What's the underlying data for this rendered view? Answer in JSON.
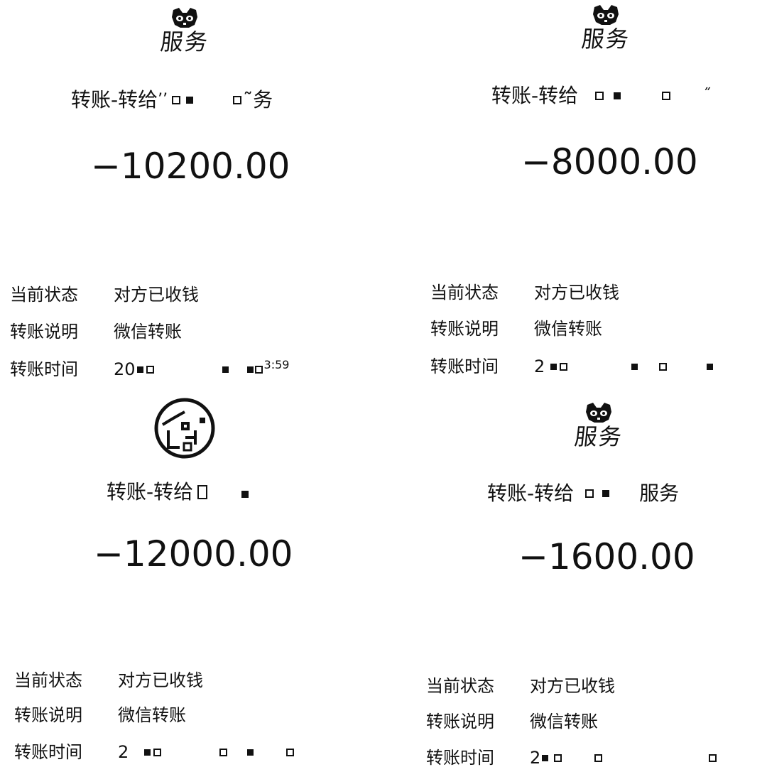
{
  "panels": [
    {
      "avatar_icon": "pixel-cat-icon",
      "avatar_name": "服务",
      "title_prefix": "转账-转给",
      "title_fragment_a": "’’",
      "title_fragment_b": "˜务",
      "amount": "−10200.00",
      "details": [
        {
          "label": "当前状态",
          "value": "对方已收钱"
        },
        {
          "label": "转账说明",
          "value": "微信转账"
        },
        {
          "label": "转账时间",
          "value_prefix": "20",
          "value_suffix": "3:59"
        }
      ]
    },
    {
      "avatar_icon": "pixel-cat-icon",
      "avatar_name": "服务",
      "title_prefix": "转账-转给",
      "title_fragment_a": "",
      "title_fragment_b": "˝",
      "amount": "−8000.00",
      "details": [
        {
          "label": "当前状态",
          "value": "对方已收钱"
        },
        {
          "label": "转账说明",
          "value": "微信转账"
        },
        {
          "label": "转账时间",
          "value_prefix": "2",
          "value_suffix": ""
        }
      ]
    },
    {
      "avatar_icon": "round-avatar-icon",
      "avatar_name": "",
      "title_prefix": "转账-转给",
      "title_fragment_a": "",
      "title_fragment_b": "",
      "amount": "−12000.00",
      "details": [
        {
          "label": "当前状态",
          "value": "对方已收钱"
        },
        {
          "label": "转账说明",
          "value": "微信转账"
        },
        {
          "label": "转账时间",
          "value_prefix": "2",
          "value_suffix": ""
        }
      ]
    },
    {
      "avatar_icon": "pixel-cat-icon",
      "avatar_name": "服务",
      "title_prefix": "转账-转给",
      "title_fragment_a": "",
      "title_fragment_b": "服务",
      "amount": "−1600.00",
      "details": [
        {
          "label": "当前状态",
          "value": "对方已收钱"
        },
        {
          "label": "转账说明",
          "value": "微信转账"
        },
        {
          "label": "转账时间",
          "value_prefix": "2",
          "value_suffix": ""
        }
      ]
    }
  ]
}
